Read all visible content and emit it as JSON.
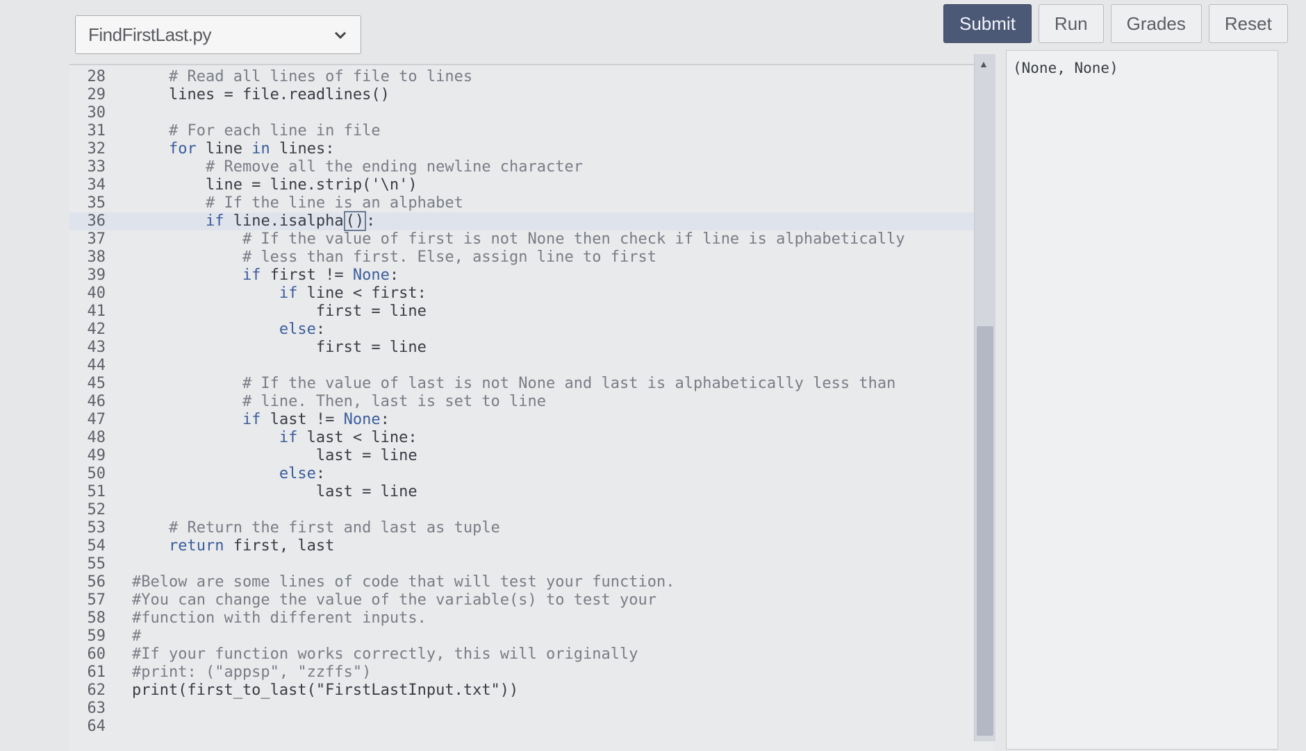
{
  "file_selector": {
    "value": "FindFirstLast.py"
  },
  "toolbar": {
    "submit": "Submit",
    "run": "Run",
    "grades": "Grades",
    "reset": "Reset"
  },
  "editor": {
    "lines": [
      {
        "n": "28",
        "code": "    # Read all lines of file to lines",
        "type": "comment"
      },
      {
        "n": "29",
        "code": "    lines = file.readlines()",
        "type": "code"
      },
      {
        "n": "30",
        "code": "",
        "type": "code"
      },
      {
        "n": "31",
        "code": "    # For each line in file",
        "type": "comment"
      },
      {
        "n": "32",
        "code": "    for line in lines:",
        "type": "code"
      },
      {
        "n": "33",
        "code": "        # Remove all the ending newline character",
        "type": "comment"
      },
      {
        "n": "34",
        "code": "        line = line.strip('\\n')",
        "type": "code"
      },
      {
        "n": "35",
        "code": "        # If the line is an alphabet",
        "type": "comment"
      },
      {
        "n": "36",
        "code": "        if line.isalpha():",
        "type": "code"
      },
      {
        "n": "37",
        "code": "            # If the value of first is not None then check if line is alphabetically",
        "type": "comment"
      },
      {
        "n": "38",
        "code": "            # less than first. Else, assign line to first",
        "type": "comment"
      },
      {
        "n": "39",
        "code": "            if first != None:",
        "type": "code"
      },
      {
        "n": "40",
        "code": "                if line < first:",
        "type": "code"
      },
      {
        "n": "41",
        "code": "                    first = line",
        "type": "code"
      },
      {
        "n": "42",
        "code": "                else:",
        "type": "code"
      },
      {
        "n": "43",
        "code": "                    first = line",
        "type": "code"
      },
      {
        "n": "44",
        "code": "",
        "type": "code"
      },
      {
        "n": "45",
        "code": "            # If the value of last is not None and last is alphabetically less than",
        "type": "comment"
      },
      {
        "n": "46",
        "code": "            # line. Then, last is set to line",
        "type": "comment"
      },
      {
        "n": "47",
        "code": "            if last != None:",
        "type": "code"
      },
      {
        "n": "48",
        "code": "                if last < line:",
        "type": "code"
      },
      {
        "n": "49",
        "code": "                    last = line",
        "type": "code"
      },
      {
        "n": "50",
        "code": "                else:",
        "type": "code"
      },
      {
        "n": "51",
        "code": "                    last = line",
        "type": "code"
      },
      {
        "n": "52",
        "code": "",
        "type": "code"
      },
      {
        "n": "53",
        "code": "    # Return the first and last as tuple",
        "type": "comment"
      },
      {
        "n": "54",
        "code": "    return first, last",
        "type": "code"
      },
      {
        "n": "55",
        "code": "",
        "type": "code"
      },
      {
        "n": "56",
        "code": "#Below are some lines of code that will test your function.",
        "type": "comment"
      },
      {
        "n": "57",
        "code": "#You can change the value of the variable(s) to test your",
        "type": "comment"
      },
      {
        "n": "58",
        "code": "#function with different inputs.",
        "type": "comment"
      },
      {
        "n": "59",
        "code": "#",
        "type": "comment"
      },
      {
        "n": "60",
        "code": "#If your function works correctly, this will originally",
        "type": "comment"
      },
      {
        "n": "61",
        "code": "#print: (\"appsp\", \"zzffs\")",
        "type": "comment"
      },
      {
        "n": "62",
        "code": "print(first_to_last(\"FirstLastInput.txt\"))",
        "type": "code"
      },
      {
        "n": "63",
        "code": "",
        "type": "code"
      },
      {
        "n": "64",
        "code": "",
        "type": "code"
      }
    ]
  },
  "output": {
    "text": "(None, None)"
  },
  "colors": {
    "submit_bg": "#4b5876",
    "keyword": "#3b5d9c",
    "comment": "#7a7c86"
  }
}
